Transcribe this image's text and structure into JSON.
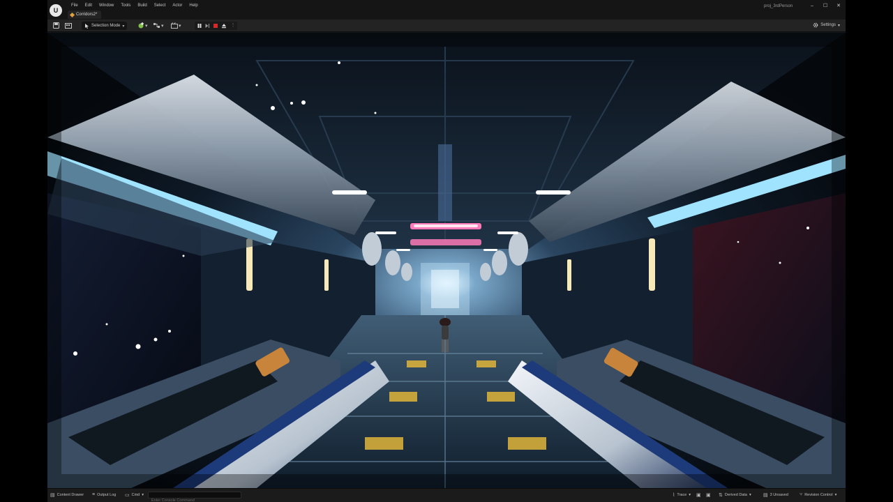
{
  "app": {
    "logo_icon": "unreal-engine-logo-icon",
    "project_name": "proj_3rdPerson"
  },
  "menu": [
    "File",
    "Edit",
    "Window",
    "Tools",
    "Build",
    "Select",
    "Actor",
    "Help"
  ],
  "level_tab": {
    "label": "Corridors2*",
    "icon": "level-icon"
  },
  "window_controls": {
    "minimize": "–",
    "maximize": "☐",
    "close": "✕"
  },
  "toolbar": {
    "save_icon": "save-icon",
    "content_icon": "content-browser-icon",
    "selection_mode_label": "Selection Mode",
    "add_icon": "add-actor-icon",
    "blueprint_icon": "blueprint-icon",
    "cinematics_icon": "cinematics-icon",
    "play_controls": [
      "pause-icon",
      "step-frame-icon",
      "stop-icon",
      "eject-icon",
      "more-options-icon"
    ],
    "settings_label": "Settings"
  },
  "viewport": {
    "scene": "sci-fi corridor with third-person character",
    "accent_light": "#9fe3ff",
    "pink_light": "#ff7ab8",
    "floor_glyph_color": "#e0b53a"
  },
  "statusbar": {
    "content_drawer_label": "Content Drawer",
    "output_log_label": "Output Log",
    "cmd_label": "Cmd",
    "console_placeholder": "Enter Console Command",
    "trace_label": "Trace",
    "derived_data_label": "Derived Data",
    "unsaved_label": "3 Unsaved",
    "revision_control_label": "Revision Control"
  }
}
